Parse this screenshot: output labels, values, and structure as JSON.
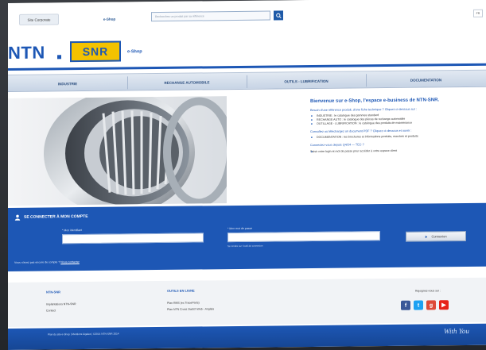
{
  "header": {
    "tab_one": "Site Corporate",
    "tab_two": "e-Shop",
    "search_placeholder": "Recherchez un produit par sa référence",
    "lang": "FR"
  },
  "brand": {
    "ntn": "NTN",
    "snr": "SNR",
    "eshop": "e-Shop"
  },
  "nav": [
    {
      "label": "INDUSTRIE"
    },
    {
      "label": "RECHANGE AUTOMOBILE"
    },
    {
      "label": "OUTILS - LUBRIFICATION"
    },
    {
      "label": "DOCUMENTATION"
    }
  ],
  "intro": {
    "title": "Bienvenue sur e-Shop, l'espace e-business de NTN-SNR.",
    "p1": "Besoin d'une référence produit, d'une fiche technique ? Cliquez ci-dessous sur :",
    "items": [
      "INDUSTRIE : le catalogue des gammes standard",
      "RECHANGE AUTO : le catalogue des pièces de rechange automobile",
      "OUTILLAGE - LUBRIFICATION : le catalogue des produits de maintenance"
    ],
    "p2": "Consultez ou téléchargez un document PDF ? Cliquez ci-dessous et ouvrir :",
    "items2": [
      "DOCUMENTATION : les brochures et informations produits, marchés et produits"
    ],
    "p3": "Connectez-vous depuis Q4/24 — TEC ?",
    "p4": "Saisir votre login et mot de passe pour accéder à votre espace client"
  },
  "login": {
    "title": "SE CONNECTER À MON COMPTE",
    "user_label": "* Mon identifiant",
    "pass_label": "* Mon mot de passe",
    "pass_hint": "Se rendre sur l'outil de connexion",
    "button": "Connexion",
    "forgot_prefix": "Vous n'avez pas encore de compte ?",
    "forgot_link": "Nous contacter"
  },
  "footer": {
    "col1_head": "NTN-SNR",
    "col1_links": [
      "Implantations NTN-SNR",
      "Contact"
    ],
    "col2_head": "OUTILS EN LIGNE",
    "col2_links": [
      "Plan RMS (ex TraceParts)",
      "Plan NTN Cross Switch Web - Anglais"
    ],
    "social_label": "Rejoignez-nous sur :",
    "copyright": "Plan du site e-Shop | Mentions légales | ©2014 NTN-SNR 2014",
    "withyou": "With You"
  },
  "icons": {
    "search": "search-icon",
    "user": "user-icon",
    "arrow": "arrow-right-icon"
  },
  "colors": {
    "brand_blue": "#1d57b5",
    "snr_yellow": "#f3c200"
  }
}
